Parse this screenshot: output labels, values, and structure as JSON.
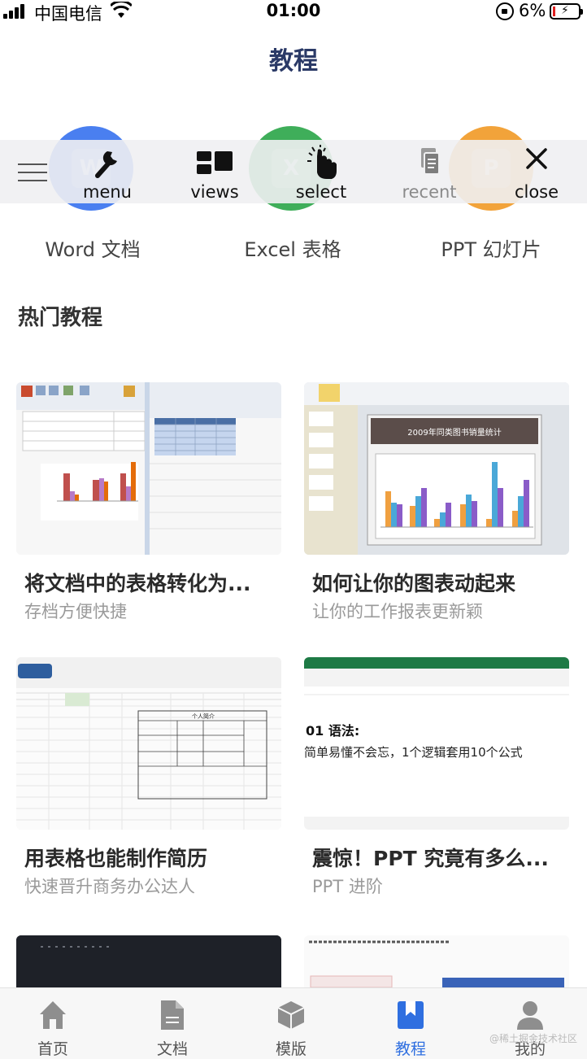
{
  "status_bar": {
    "carrier": "中国电信",
    "time": "01:00",
    "battery": "6%"
  },
  "header": {
    "title": "教程"
  },
  "categories": [
    {
      "label": "Word 文档",
      "color": "#4a7ff0",
      "glyph": "W"
    },
    {
      "label": "Excel 表格",
      "color": "#3fae5a",
      "glyph": "X"
    },
    {
      "label": "PPT 幻灯片",
      "color": "#f2a33a",
      "glyph": "P"
    }
  ],
  "toolbar": {
    "items": [
      {
        "label": "menu",
        "icon": "wrench-icon"
      },
      {
        "label": "views",
        "icon": "views-icon"
      },
      {
        "label": "select",
        "icon": "hand-pointer-icon"
      },
      {
        "label": "recent",
        "icon": "documents-icon"
      },
      {
        "label": "close",
        "icon": "close-icon"
      }
    ]
  },
  "section": {
    "title": "热门教程"
  },
  "tutorials": [
    {
      "title": "将文档中的表格转化为...",
      "subtitle": "存档方便快捷"
    },
    {
      "title": "如何让你的图表动起来",
      "subtitle": "让你的工作报表更新颖",
      "thumb_text": "2009年同类图书销量统计"
    },
    {
      "title": "用表格也能制作简历",
      "subtitle": "快速晋升商务办公达人",
      "thumb_text": "个人简介"
    },
    {
      "title": "震惊！PPT 究竟有多么...",
      "subtitle": "PPT 进阶",
      "thumb_heading": "01 语法:",
      "thumb_text": "简单易懂不会忘，1个逻辑套用10个公式"
    },
    {
      "title": "",
      "subtitle": ""
    },
    {
      "title": "",
      "subtitle": ""
    }
  ],
  "tabbar": {
    "items": [
      {
        "label": "首页",
        "icon": "home-icon"
      },
      {
        "label": "文档",
        "icon": "document-icon"
      },
      {
        "label": "模版",
        "icon": "cube-icon"
      },
      {
        "label": "教程",
        "icon": "bookmark-icon",
        "active": true
      },
      {
        "label": "我的",
        "icon": "user-icon"
      }
    ]
  },
  "watermark": "@稀土掘金技术社区",
  "colors": {
    "title": "#2b3a67",
    "active_tab": "#2f6fe0",
    "inactive_tab": "#8e8e8e"
  }
}
